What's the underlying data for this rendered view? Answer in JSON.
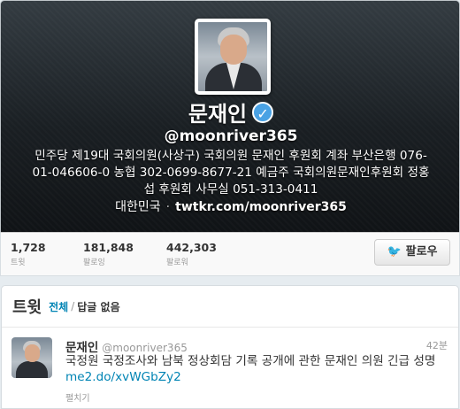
{
  "profile": {
    "name": "문재인",
    "handle": "@moonriver365",
    "bio": "민주당 제19대 국회의원(사상구) 국회의원 문재인 후원회 계좌  부산은행 076-01-046606-0 농협 302-0699-8677-21 예금주 국회의원문재인후원회 정홍섭 후원회 사무실 051-313-0411",
    "location": "대한민국",
    "separator": "·",
    "url": "twtkr.com/moonriver365"
  },
  "stats": [
    {
      "value": "1,728",
      "label": "트윗"
    },
    {
      "value": "181,848",
      "label": "팔로잉"
    },
    {
      "value": "442,303",
      "label": "팔로워"
    }
  ],
  "follow_button": {
    "label": "팔로우",
    "icon": "twitter-bird-icon"
  },
  "tweets_section": {
    "title": "트윗",
    "filter_all": "전체",
    "filter_separator": "/",
    "filter_no_replies": "답글 없음"
  },
  "tweet": {
    "name": "문재인",
    "handle": "@moonriver365",
    "time": "42분",
    "text": "국정원 국정조사와 남북 정상회담 기록 공개에 관한 문재인 의원 긴급 성명 ",
    "link": "me2.do/xvWGbZy2",
    "expand": "펼치기"
  },
  "colors": {
    "link": "#0084b4",
    "verified": "#4aa2e4",
    "header_dark": "#1a1f23"
  }
}
